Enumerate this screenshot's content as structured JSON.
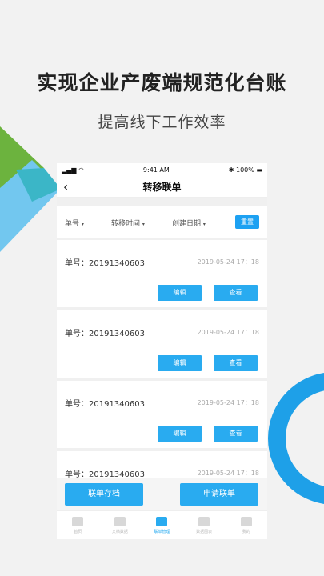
{
  "headline": "实现企业产废端规范化台账",
  "subline": "提高线下工作效率",
  "status": {
    "time": "9:41 AM",
    "battery": "100%"
  },
  "nav": {
    "back": "‹",
    "title": "转移联单"
  },
  "filter": {
    "order_no": "单号",
    "transfer_time": "转移时间",
    "created_date": "创建日期",
    "reset": "重置"
  },
  "cards": [
    {
      "no": "单号：20191340603",
      "date": "2019-05-24 17：18",
      "edit": "编辑",
      "view": "查看"
    },
    {
      "no": "单号：20191340603",
      "date": "2019-05-24 17：18",
      "edit": "编辑",
      "view": "查看"
    },
    {
      "no": "单号：20191340603",
      "date": "2019-05-24 17：18",
      "edit": "编辑",
      "view": "查看"
    },
    {
      "no": "单号：20191340603",
      "date": "2019-05-24 17：18"
    }
  ],
  "actions": {
    "archive": "联单存档",
    "apply": "申请联单"
  },
  "tabs": [
    "首页",
    "文档数据",
    "联单管理",
    "数据图表",
    "我的"
  ],
  "colors": {
    "accent": "#29abf0",
    "green": "#6cb33e",
    "teal": "#3bb6c7",
    "lightblue": "#72c7ef",
    "ring": "#1ea0e8"
  }
}
